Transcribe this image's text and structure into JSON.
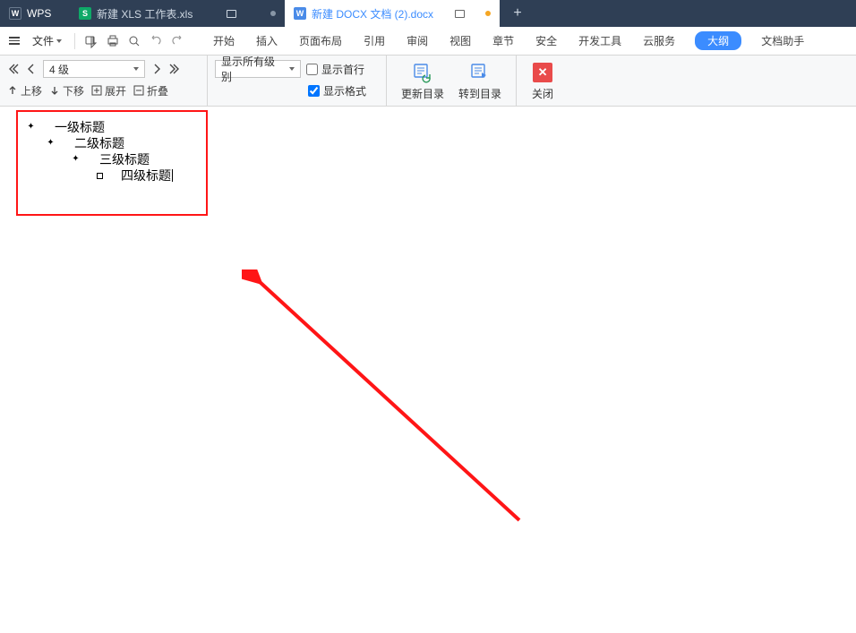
{
  "tabs": {
    "wps": "WPS",
    "file1": "新建 XLS 工作表.xls",
    "file2": "新建 DOCX 文档 (2).docx",
    "add": "+"
  },
  "menubar": {
    "file": "文件",
    "items": [
      "开始",
      "插入",
      "页面布局",
      "引用",
      "审阅",
      "视图",
      "章节",
      "安全",
      "开发工具",
      "云服务",
      "大纲",
      "文档助手"
    ]
  },
  "toolbar": {
    "level_sel": "4 级",
    "show_level": "显示所有级别",
    "up": "上移",
    "down": "下移",
    "expand": "展开",
    "collapse": "折叠",
    "show_first": "显示首行",
    "show_format": "显示格式",
    "update_toc": "更新目录",
    "goto_toc": "转到目录",
    "close": "关闭"
  },
  "outline": {
    "h1": "一级标题",
    "h2": "二级标题",
    "h3": "三级标题",
    "h4": "四级标题"
  }
}
